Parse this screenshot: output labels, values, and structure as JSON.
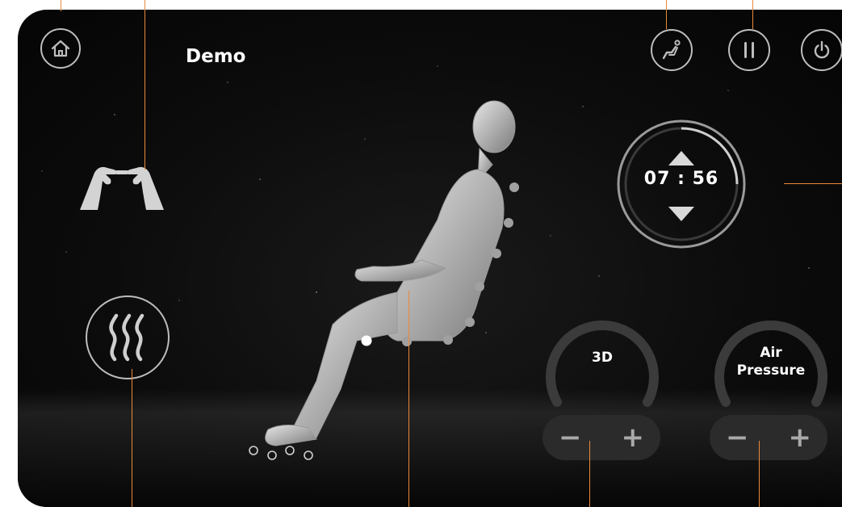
{
  "header": {
    "title": "Demo"
  },
  "icons": {
    "home": "home-icon",
    "recline": "recline-chair-icon",
    "pause": "pause-icon",
    "power": "power-icon",
    "hands": "kneading-hands-icon",
    "heat": "heat-icon",
    "timer_up": "triangle-up-icon",
    "timer_down": "triangle-down-icon"
  },
  "timer": {
    "hours": "07",
    "separator": ":",
    "minutes": "56",
    "progress": 0.25
  },
  "controls": {
    "mode_3d": {
      "label": "3D",
      "minus": "−",
      "plus": "+"
    },
    "air_pressure": {
      "label_line1": "Air",
      "label_line2": "Pressure",
      "minus": "−",
      "plus": "+"
    }
  },
  "colors": {
    "accent_guides": "#e98a3b",
    "background": "#0b0b0b",
    "ring": "#bdbdbd"
  }
}
